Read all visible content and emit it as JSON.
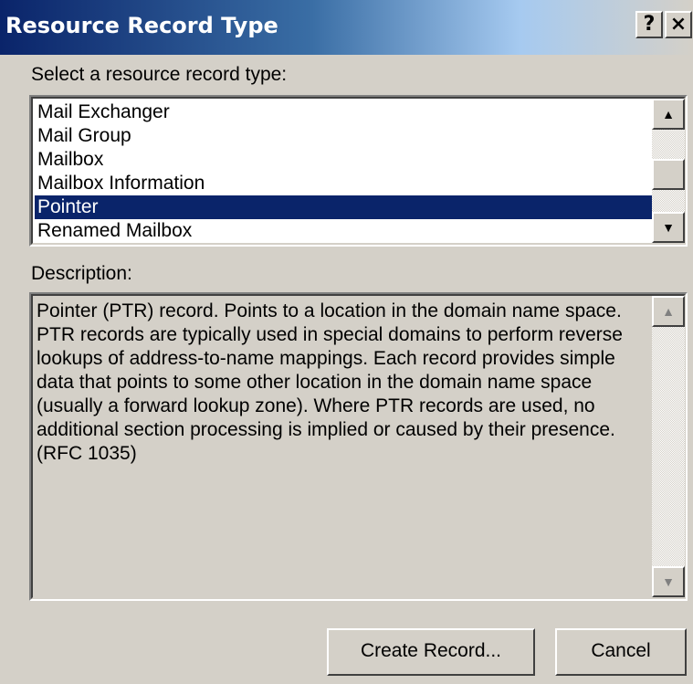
{
  "window": {
    "title": "Resource Record Type",
    "help_label": "?",
    "close_label": "×"
  },
  "record_type": {
    "label": "Select a resource record type:",
    "items": [
      "Mail Exchanger",
      "Mail Group",
      "Mailbox",
      "Mailbox Information",
      "Pointer",
      "Renamed Mailbox"
    ],
    "selected": "Pointer"
  },
  "description": {
    "label": "Description:",
    "text": "Pointer (PTR) record. Points to a location in the domain name space. PTR records are typically used in special domains to perform reverse lookups of address-to-name mappings. Each record provides simple data that points to some other location in the domain name space (usually a forward lookup zone). Where PTR records are used, no additional section processing is implied or caused by their presence. (RFC 1035)"
  },
  "buttons": {
    "create": "Create Record...",
    "cancel": "Cancel"
  },
  "colors": {
    "titlebar_start": "#0a246a",
    "selection": "#0a246a",
    "face": "#d4d0c8"
  },
  "icons": {
    "scroll_up": "up-arrow-icon",
    "scroll_down": "down-arrow-icon"
  }
}
